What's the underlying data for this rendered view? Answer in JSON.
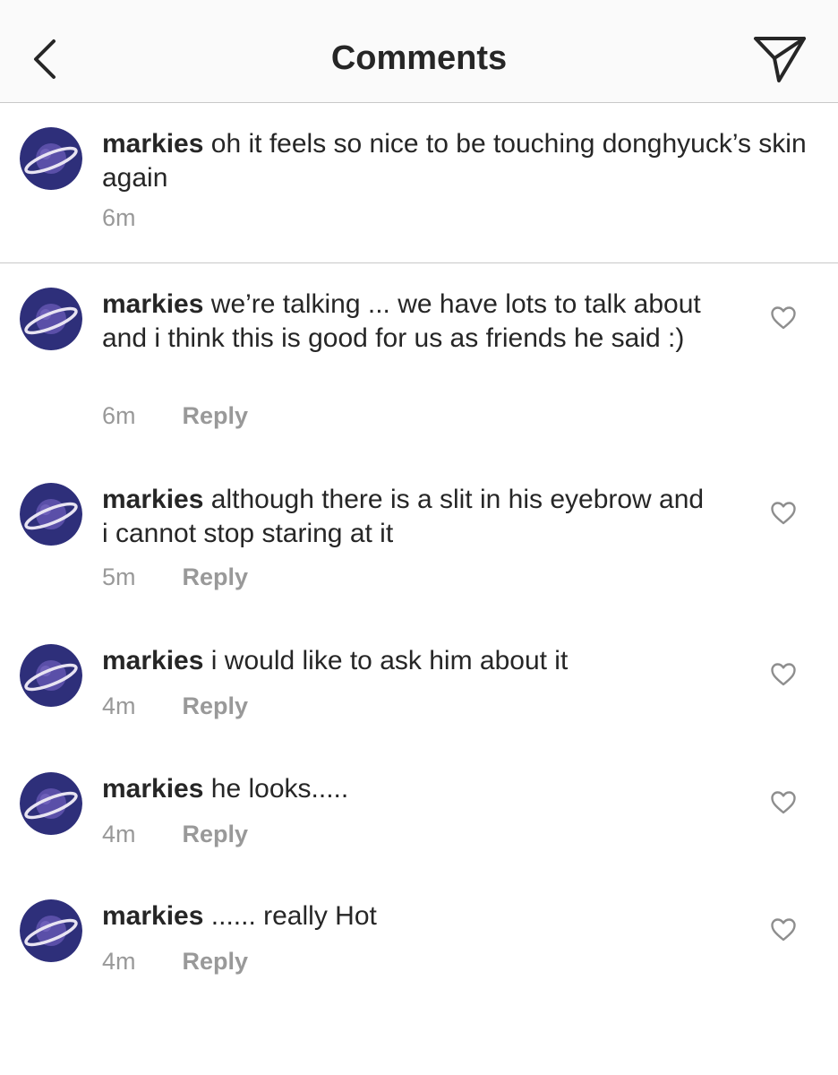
{
  "header": {
    "title": "Comments",
    "back_icon": "chevron-left-icon",
    "send_icon": "paper-plane-icon"
  },
  "caption": {
    "username": "markies",
    "text": "oh it feels so nice to be touching donghyuck’s skin again",
    "time": "6m"
  },
  "comments": [
    {
      "username": "markies",
      "text": "we’re talking ... we have lots to talk about and i think this is good for us as friends he said :)",
      "time": "6m",
      "reply": "Reply"
    },
    {
      "username": "markies",
      "text": "although there is a slit in his eyebrow and i cannot stop staring at it",
      "time": "5m",
      "reply": "Reply"
    },
    {
      "username": "markies",
      "text": "i would like to ask him about it",
      "time": "4m",
      "reply": "Reply"
    },
    {
      "username": "markies",
      "text": "he looks.....",
      "time": "4m",
      "reply": "Reply"
    },
    {
      "username": "markies",
      "text": "...... really Hot",
      "time": "4m",
      "reply": "Reply"
    }
  ],
  "colors": {
    "text": "#262626",
    "muted": "#999999",
    "avatar_bg": "#2e2f7a",
    "divider": "#c8c8c8"
  }
}
